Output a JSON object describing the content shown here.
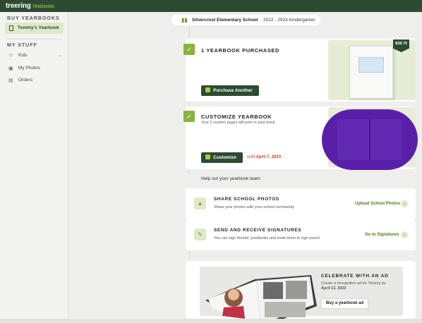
{
  "app": {
    "logo_main": "treering",
    "logo_sub": "Yearbooks"
  },
  "sidebar": {
    "buy_heading": "BUY YEARBOOKS",
    "active_item": "Tommy's Yearbook",
    "my_stuff_heading": "MY STUFF",
    "items": [
      {
        "label": "Kids",
        "icon": "smiley-icon"
      },
      {
        "label": "My Photos",
        "icon": "photo-icon"
      },
      {
        "label": "Orders",
        "icon": "document-icon"
      }
    ]
  },
  "school": {
    "name": "Silvercrest Elementary School",
    "year_grade": "2022 - 2023 Kindergarten"
  },
  "purchased": {
    "title": "1 YEARBOOK PURCHASED",
    "button": "Purchase Another",
    "price": "$38.75"
  },
  "customize": {
    "title": "CUSTOMIZE YEARBOOK",
    "subtitle": "Your 2 custom pages will print in your book.",
    "button": "Customize",
    "deadline_prefix": "until",
    "deadline": "April 7, 2023"
  },
  "help_text": "Help out your yearbook team:",
  "share": {
    "title": "SHARE SCHOOL PHOTOS",
    "subtitle": "Share your photos with your school community",
    "link": "Upload School Photos"
  },
  "signatures": {
    "title": "SEND AND RECEIVE SIGNATURES",
    "subtitle": "You can sign friends' yearbooks and invite them to sign yours!",
    "link": "Go to Signatures"
  },
  "ad": {
    "title": "CELEBRATE WITH AN AD",
    "subtitle": "Create a recognition ad for Tommy by",
    "deadline": "April 13, 2023",
    "button": "Buy a yearbook ad"
  },
  "colors": {
    "brand_dark": "#2d4a32",
    "accent_green": "#87b33e",
    "deadline_red": "#c0392b"
  }
}
